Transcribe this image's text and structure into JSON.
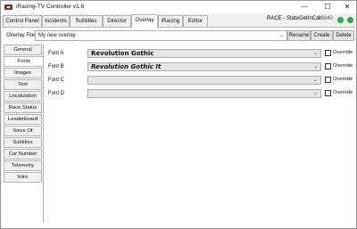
{
  "window": {
    "title": "iRacing-TV Controller v1.8",
    "controls": {
      "minimize": "—",
      "maximize": "☐",
      "close": "✕"
    }
  },
  "tabs": [
    {
      "label": "Control Panel"
    },
    {
      "label": "Incidents"
    },
    {
      "label": "Subtitles"
    },
    {
      "label": "Director"
    },
    {
      "label": "Overlay",
      "active": true
    },
    {
      "label": "iRacing"
    },
    {
      "label": "Editor"
    }
  ],
  "status": {
    "race": "RACE - StateGetInCar",
    "number": "38040",
    "colors": {
      "indicator": "#2ea84a"
    }
  },
  "overlay": {
    "label": "Overlay File",
    "value": "My new overlay",
    "buttons": {
      "rename": "Rename",
      "create": "Create",
      "delete": "Delete"
    }
  },
  "sidebar": {
    "items": [
      {
        "label": "General"
      },
      {
        "label": "Fonts",
        "active": true
      },
      {
        "label": "Images"
      },
      {
        "label": "Text"
      },
      {
        "label": "Localization"
      },
      {
        "label": "Race Status"
      },
      {
        "label": "Leaderboard"
      },
      {
        "label": "Voice Of"
      },
      {
        "label": "Subtitles"
      },
      {
        "label": "Car Number"
      },
      {
        "label": "Telemetry"
      },
      {
        "label": "Intro"
      }
    ]
  },
  "fonts": [
    {
      "label": "Font A",
      "value": "Revolution Gothic",
      "override": "Override"
    },
    {
      "label": "Font B",
      "value": "Revolution Gothic It",
      "override": "Override"
    },
    {
      "label": "Font C",
      "value": "",
      "override": "Override"
    },
    {
      "label": "Font D",
      "value": "",
      "override": "Override"
    }
  ]
}
